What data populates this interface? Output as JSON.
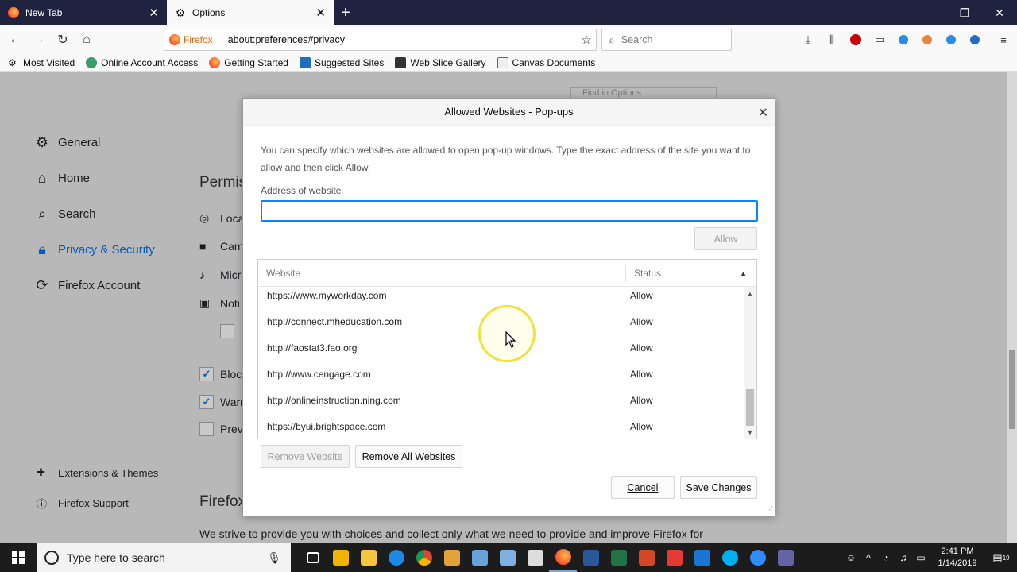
{
  "browser": {
    "tabs": [
      {
        "label": "New Tab",
        "active": false
      },
      {
        "label": "Options",
        "active": true
      }
    ],
    "url_identity": "Firefox",
    "url": "about:preferences#privacy",
    "search_placeholder": "Search",
    "bookmarks": [
      "Most Visited",
      "Online Account Access",
      "Getting Started",
      "Suggested Sites",
      "Web Slice Gallery",
      "Canvas Documents"
    ]
  },
  "prefs": {
    "find_placeholder": "Find in Options",
    "sidebar": [
      {
        "label": "General",
        "icon": "gear-icon"
      },
      {
        "label": "Home",
        "icon": "home-icon"
      },
      {
        "label": "Search",
        "icon": "search-icon"
      },
      {
        "label": "Privacy & Security",
        "icon": "lock-icon"
      },
      {
        "label": "Firefox Account",
        "icon": "sync-icon"
      }
    ],
    "sidebar_bottom": [
      "Extensions & Themes",
      "Firefox Support"
    ],
    "bg_heading_1": "Permis",
    "bg_rows": [
      "Loca",
      "Cam",
      "Micr",
      "Noti"
    ],
    "bg_checks": [
      "Block",
      "Warn",
      "Preve"
    ],
    "bg_heading_2": "Firefox",
    "bg_para": "We strive to provide you with choices and collect only what we need to provide and improve Firefox for"
  },
  "dialog": {
    "title": "Allowed Websites - Pop-ups",
    "description": "You can specify which websites are allowed to open pop-up windows. Type the exact address of the site you want to allow and then click Allow.",
    "address_label": "Address of website",
    "address_value": "",
    "allow_button": "Allow",
    "columns": {
      "website": "Website",
      "status": "Status"
    },
    "rows": [
      {
        "website": "https://www.myworkday.com",
        "status": "Allow"
      },
      {
        "website": "http://connect.mheducation.com",
        "status": "Allow"
      },
      {
        "website": "http://faostat3.fao.org",
        "status": "Allow"
      },
      {
        "website": "http://www.cengage.com",
        "status": "Allow"
      },
      {
        "website": "http://onlineinstruction.ning.com",
        "status": "Allow"
      },
      {
        "website": "https://byui.brightspace.com",
        "status": "Allow"
      }
    ],
    "remove_website": "Remove Website",
    "remove_all": "Remove All Websites",
    "cancel": "Cancel",
    "save": "Save Changes"
  },
  "taskbar": {
    "search_placeholder": "Type here to search",
    "time": "2:41 PM",
    "date": "1/14/2019",
    "notifications": "19"
  },
  "colors": {
    "accent": "#0a84ff",
    "active_nav": "#0a5bb5"
  }
}
